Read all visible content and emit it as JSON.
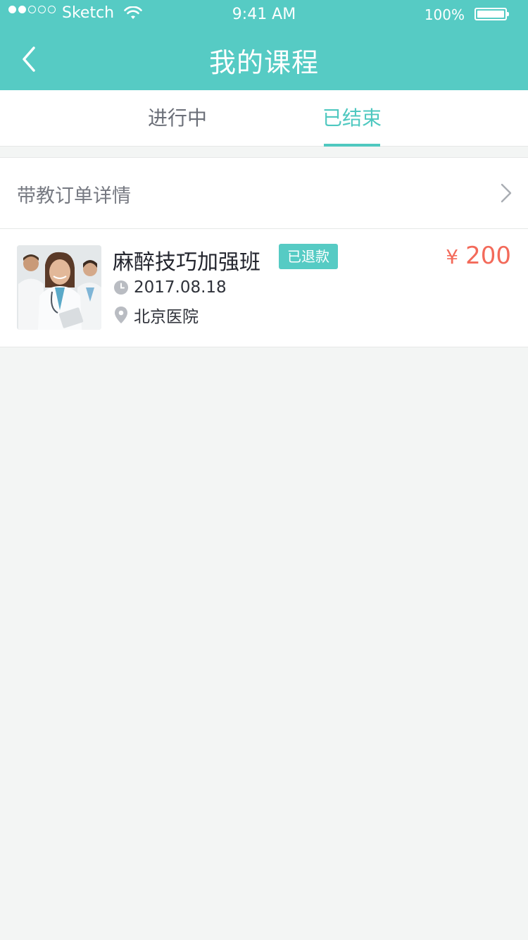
{
  "status_bar": {
    "carrier": "Sketch",
    "time": "9:41 AM",
    "battery": "100%"
  },
  "nav": {
    "title": "我的课程"
  },
  "tabs": [
    {
      "label": "进行中",
      "active": false
    },
    {
      "label": "已结束",
      "active": true
    }
  ],
  "order_detail": {
    "label": "带教订单详情"
  },
  "course": {
    "title": "麻醉技巧加强班",
    "badge": "已退款",
    "price_symbol": "¥",
    "price": "200",
    "date": "2017.08.18",
    "location": "北京医院"
  },
  "colors": {
    "accent": "#56CBC4",
    "price": "#F36A5A",
    "background": "#F3F5F4"
  }
}
